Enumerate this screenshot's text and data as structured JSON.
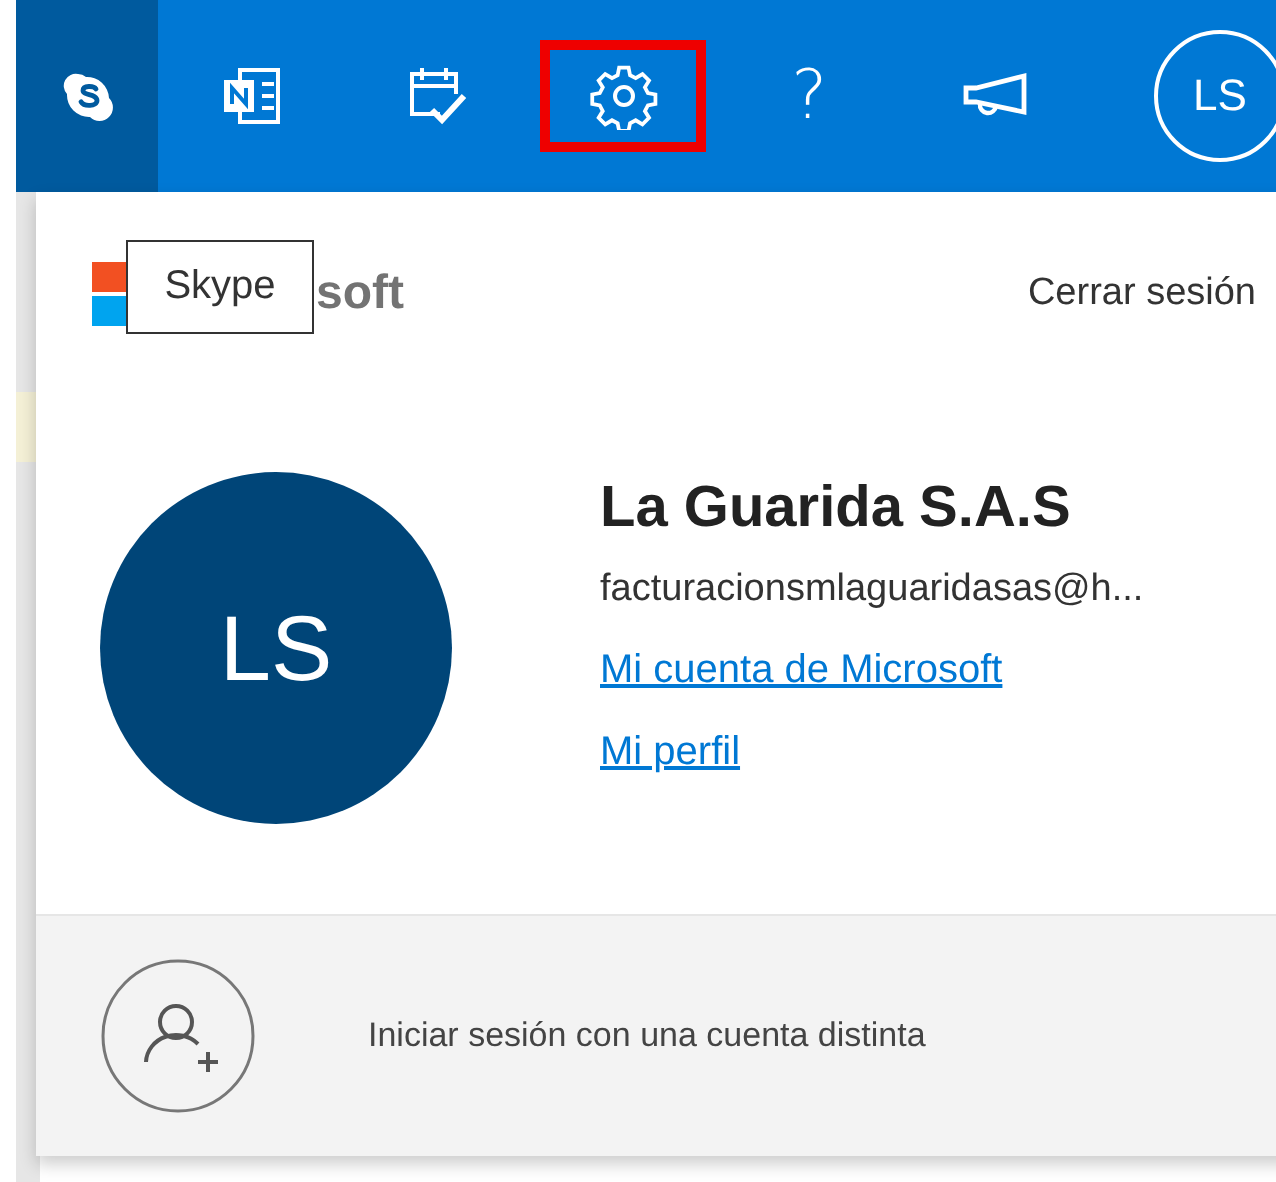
{
  "top_bar": {
    "items": [
      {
        "kind": "skype",
        "selected": true,
        "highlighted": false
      },
      {
        "kind": "onenote",
        "selected": false,
        "highlighted": false
      },
      {
        "kind": "tasks",
        "selected": false,
        "highlighted": false
      },
      {
        "kind": "settings",
        "selected": false,
        "highlighted": true
      },
      {
        "kind": "help",
        "label": "?",
        "selected": false,
        "highlighted": false
      },
      {
        "kind": "feedback",
        "selected": false,
        "highlighted": false
      },
      {
        "kind": "avatar",
        "label": "LS",
        "selected": false,
        "highlighted": false
      }
    ]
  },
  "tooltip": {
    "text": "Skype"
  },
  "account_panel": {
    "brand_text": "soft",
    "sign_out": "Cerrar sesión",
    "avatar_initials": "LS",
    "name": "La Guarida S.A.S",
    "email": "facturacionsmlaguaridasas@h...",
    "links": [
      "Mi cuenta de Microsoft",
      "Mi perfil"
    ],
    "switch_account": "Iniciar sesión con una cuenta distinta"
  }
}
